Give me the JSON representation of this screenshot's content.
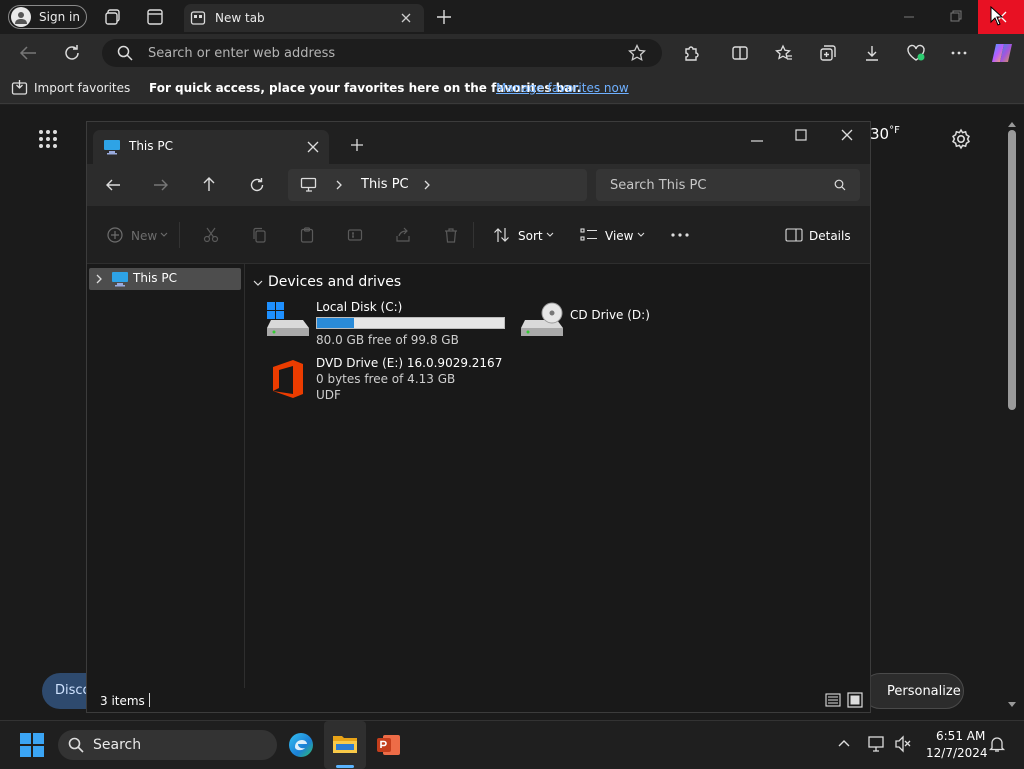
{
  "browser": {
    "signin_label": "Sign in",
    "tab_title": "New tab",
    "address_placeholder": "Search or enter web address",
    "favorites_bar": {
      "import_label": "Import favorites",
      "message": "For quick access, place your favorites here on the favorites bar.",
      "manage_link": "Manage favorites now"
    },
    "colors": {
      "close_button": "#e81123",
      "link": "#6fb0ff"
    }
  },
  "newtab": {
    "weather_temp": "30",
    "weather_unit": "°F",
    "discover_label": "Disco",
    "personalize_label": "Personalize"
  },
  "explorer": {
    "tab_title": "This PC",
    "breadcrumb": "This PC",
    "search_placeholder": "Search This PC",
    "commands": {
      "new": "New",
      "sort": "Sort",
      "view": "View",
      "details": "Details"
    },
    "nav_pane": {
      "selected": "This PC"
    },
    "group_header": "Devices and drives",
    "drives": {
      "c": {
        "name": "Local Disk (C:)",
        "free_text": "80.0 GB free of 99.8 GB",
        "used_fraction": 0.2
      },
      "d": {
        "name": "CD Drive (D:)"
      },
      "e": {
        "name": "DVD Drive (E:) 16.0.9029.2167",
        "free_text": "0 bytes free of 4.13 GB",
        "filesystem": "UDF"
      }
    },
    "status": "3 items"
  },
  "taskbar": {
    "search_label": "Search",
    "time": "6:51 AM",
    "date": "12/7/2024"
  }
}
